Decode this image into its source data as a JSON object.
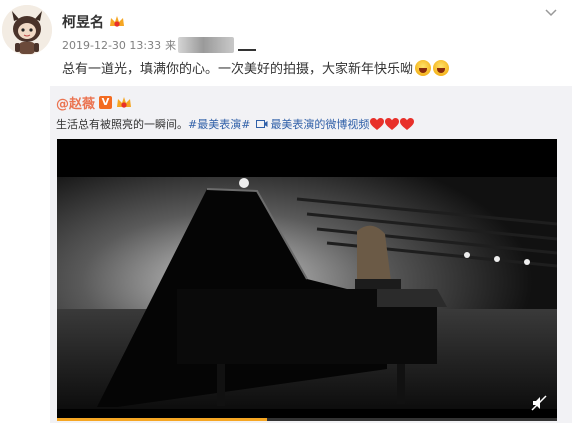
{
  "post": {
    "author": "柯昱名",
    "time": "2019-12-30 13:33",
    "source_prefix": "来",
    "text": "总有一道光，填满你的心。一次美好的拍摄，大家新年快乐呦"
  },
  "repost": {
    "author": "@赵薇",
    "verified_label": "V",
    "text": "生活总有被照亮的一瞬间。",
    "tag": "#最美表演#",
    "video_link": "最美表演的微博视频"
  },
  "video": {
    "progress": 0.42
  },
  "icons": {
    "avatar": "cartoon-avatar-icon",
    "chevron": "chevron-down-icon",
    "mute": "mute-icon",
    "video_link": "video-camera-icon",
    "heart": "heart-icon",
    "emoji": "laughing-emoji-icon"
  },
  "colors": {
    "accent": "#eb7350",
    "link": "#2f5fa8",
    "progress": "#f5a623",
    "heart": "#e8302a"
  }
}
